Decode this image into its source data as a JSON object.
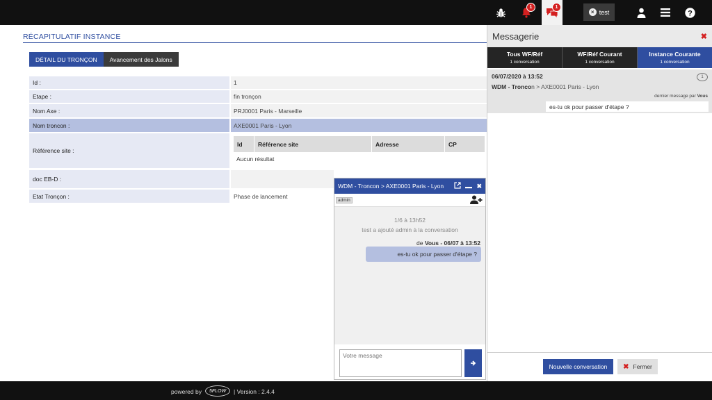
{
  "topbar": {
    "bug_icon": "bug-icon",
    "notifications": {
      "icon": "bell-icon",
      "badge": "1"
    },
    "messages": {
      "icon": "chat-icon",
      "badge": "1"
    },
    "user_chip": "test",
    "user_icon": "user-icon",
    "menu_icon": "menu-icon",
    "help_icon": "help-icon"
  },
  "page": {
    "title": "RÉCAPITULATIF INSTANCE",
    "tabs": [
      {
        "label": "DÉTAIL DU TRONÇON",
        "active": true
      },
      {
        "label": "Avancement des Jalons",
        "active": false
      }
    ]
  },
  "details": {
    "rows": [
      {
        "label": "Id :",
        "value": "1"
      },
      {
        "label": "Etape :",
        "value": "fin tronçon"
      },
      {
        "label": "Nom Axe :",
        "value": "PRJ0001 Paris - Marseille"
      },
      {
        "label": "Nom troncon :",
        "value": "AXE0001 Paris - Lyon"
      },
      {
        "label": "Référence site :",
        "value": ""
      },
      {
        "label": "doc EB-D :",
        "value": ""
      },
      {
        "label": "Etat Tronçon :",
        "value": "Phase de lancement"
      }
    ],
    "site_table": {
      "columns": [
        "Id",
        "Référence site",
        "Adresse",
        "CP"
      ],
      "empty_text": "Aucun résultat"
    }
  },
  "messagerie": {
    "title": "Messagerie",
    "tabs": [
      {
        "label": "Tous WF/Réf",
        "sub": "1 conversation",
        "active": false
      },
      {
        "label": "WF/Réf Courant",
        "sub": "1 conversation",
        "active": false
      },
      {
        "label": "Instance Courante",
        "sub": "1 conversation",
        "active": true
      }
    ],
    "conversation": {
      "date": "06/07/2020 à 13:52",
      "path_bold": "WDM - Tronco",
      "path_rest": "n > AXE0001 Paris - Lyon",
      "last_label": "dernier message par",
      "last_author": "Vous",
      "preview": "es-tu ok pour passer d'étape ?",
      "count_icon": "comment-icon"
    },
    "new_button": "Nouvelle conversation",
    "close_button": "Fermer"
  },
  "chat": {
    "title": "WDM - Troncon > AXE0001 Paris - Lyon",
    "participant": "admin",
    "system_date": "1/6 à 13h52",
    "system_text": "test a ajouté admin à la conversation",
    "meta_prefix": "de",
    "meta_author": "Vous -",
    "meta_date": "06/07 à 13:52",
    "message": "es-tu ok pour passer d'étape ?",
    "input_placeholder": "Votre message"
  },
  "footer": {
    "powered_by": "powered by",
    "logo_text": "5FLOW",
    "version": "|  Version : 2.4.4"
  }
}
